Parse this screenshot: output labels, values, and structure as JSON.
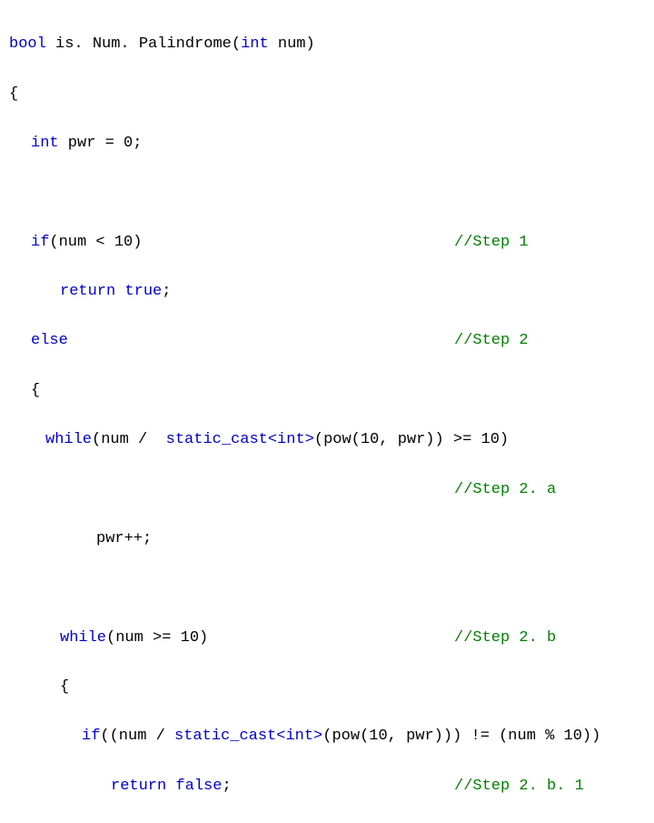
{
  "code": {
    "l1_kw1": "bool",
    "l1_txt": " is. Num. Palindrome(",
    "l1_kw2": "int",
    "l1_txt2": " num)",
    "l2": "{",
    "l3_kw": "int",
    "l3_txt": " pwr = 0;",
    "l5_kw": "if",
    "l5_txt": "(num < 10)",
    "l5_cmt": "//Step 1",
    "l6_kw": "return",
    "l6_txt": " ",
    "l6_kw2": "true",
    "l6_txt2": ";",
    "l7_kw": "else",
    "l7_cmt": "//Step 2",
    "l8": "{",
    "l9_kw": "while",
    "l9_txt": "(num /  ",
    "l9_kw2": "static_cast",
    "l9_tmpl": "<int>",
    "l9_txt2": "(pow(10, pwr)) >= 10)",
    "l10_cmt": "//Step 2. a",
    "l11_txt": "pwr++;",
    "l13_kw": "while",
    "l13_txt": "(num >= 10)",
    "l13_cmt": "//Step 2. b",
    "l14": "{",
    "l15_kw": "if",
    "l15_txt": "((num / ",
    "l15_kw2": "static_cast",
    "l15_tmpl": "<int>",
    "l15_txt2": "(pow(10, pwr))) != (num % 10))",
    "l16_kw": "return",
    "l16_txt": " ",
    "l16_kw2": "false",
    "l16_txt2": ";",
    "l16_cmt": "//Step 2. b. 1"
  }
}
